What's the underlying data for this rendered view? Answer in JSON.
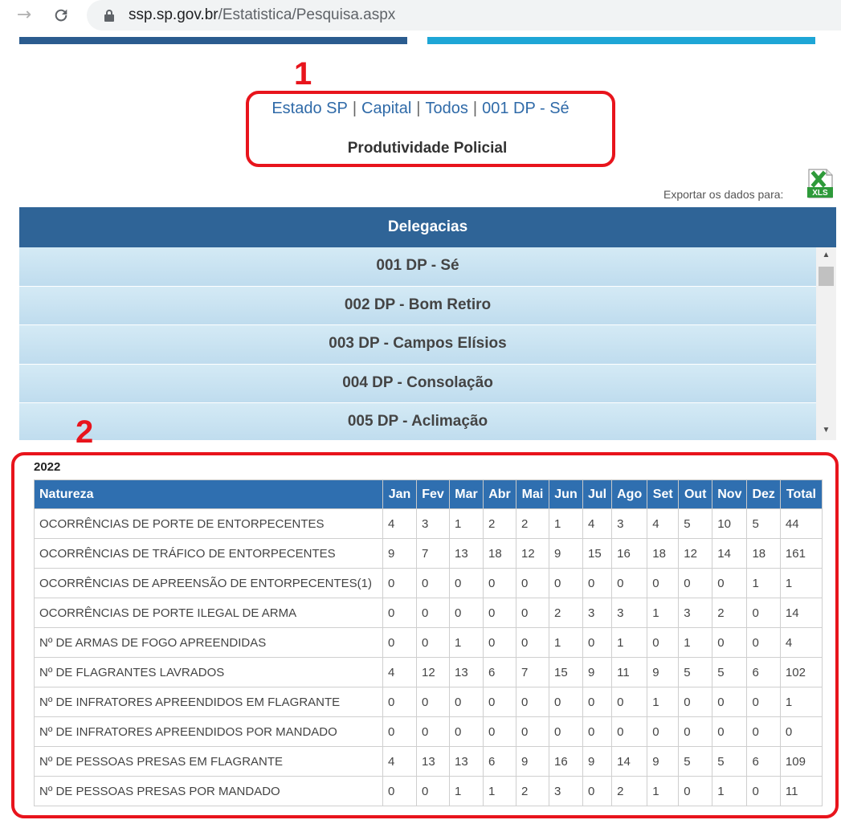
{
  "browser": {
    "url_domain": "ssp.sp.gov.br",
    "url_path": "/Estatistica/Pesquisa.aspx"
  },
  "annotations": [
    "1",
    "2"
  ],
  "breadcrumb": {
    "items": [
      "Estado SP",
      "Capital",
      "Todos",
      "001 DP - Sé"
    ],
    "separator": "|"
  },
  "page_title": "Produtividade Policial",
  "export": {
    "label": "Exportar os dados para:",
    "icon_text": "XLS"
  },
  "delegacias": {
    "header": "Delegacias",
    "items": [
      "001 DP - Sé",
      "002 DP - Bom Retiro",
      "003 DP - Campos Elísios",
      "004 DP - Consolação",
      "005 DP - Aclimação"
    ]
  },
  "table": {
    "year": "2022",
    "headers": [
      "Natureza",
      "Jan",
      "Fev",
      "Mar",
      "Abr",
      "Mai",
      "Jun",
      "Jul",
      "Ago",
      "Set",
      "Out",
      "Nov",
      "Dez",
      "Total"
    ],
    "rows": [
      [
        "OCORRÊNCIAS DE PORTE DE ENTORPECENTES",
        "4",
        "3",
        "1",
        "2",
        "2",
        "1",
        "4",
        "3",
        "4",
        "5",
        "10",
        "5",
        "44"
      ],
      [
        "OCORRÊNCIAS DE TRÁFICO DE ENTORPECENTES",
        "9",
        "7",
        "13",
        "18",
        "12",
        "9",
        "15",
        "16",
        "18",
        "12",
        "14",
        "18",
        "161"
      ],
      [
        "OCORRÊNCIAS DE APREENSÃO DE ENTORPECENTES(1)",
        "0",
        "0",
        "0",
        "0",
        "0",
        "0",
        "0",
        "0",
        "0",
        "0",
        "0",
        "1",
        "1"
      ],
      [
        "OCORRÊNCIAS DE PORTE ILEGAL DE ARMA",
        "0",
        "0",
        "0",
        "0",
        "0",
        "2",
        "3",
        "3",
        "1",
        "3",
        "2",
        "0",
        "14"
      ],
      [
        "Nº DE ARMAS DE FOGO APREENDIDAS",
        "0",
        "0",
        "1",
        "0",
        "0",
        "1",
        "0",
        "1",
        "0",
        "1",
        "0",
        "0",
        "4"
      ],
      [
        "Nº DE FLAGRANTES LAVRADOS",
        "4",
        "12",
        "13",
        "6",
        "7",
        "15",
        "9",
        "11",
        "9",
        "5",
        "5",
        "6",
        "102"
      ],
      [
        "Nº DE INFRATORES APREENDIDOS EM FLAGRANTE",
        "0",
        "0",
        "0",
        "0",
        "0",
        "0",
        "0",
        "0",
        "1",
        "0",
        "0",
        "0",
        "1"
      ],
      [
        "Nº DE INFRATORES APREENDIDOS POR MANDADO",
        "0",
        "0",
        "0",
        "0",
        "0",
        "0",
        "0",
        "0",
        "0",
        "0",
        "0",
        "0",
        "0"
      ],
      [
        "Nº DE PESSOAS PRESAS EM FLAGRANTE",
        "4",
        "13",
        "13",
        "6",
        "9",
        "16",
        "9",
        "14",
        "9",
        "5",
        "5",
        "6",
        "109"
      ],
      [
        "Nº DE PESSOAS PRESAS POR MANDADO",
        "0",
        "0",
        "1",
        "1",
        "2",
        "3",
        "0",
        "2",
        "1",
        "0",
        "1",
        "0",
        "11"
      ]
    ]
  },
  "colors": {
    "annotation_red": "#e8141c",
    "header_blue": "#2f6497",
    "link_blue": "#2f6aa8"
  }
}
